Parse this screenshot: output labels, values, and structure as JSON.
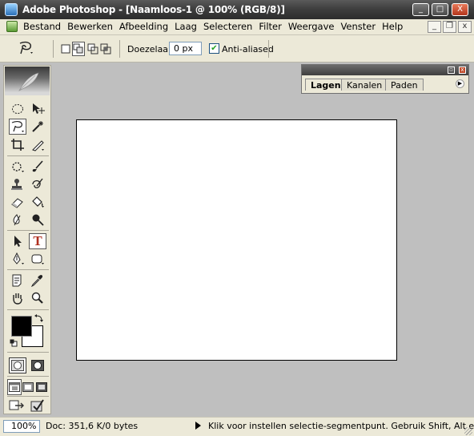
{
  "window": {
    "title": "Adobe Photoshop - [Naamloos-1 @ 100% (RGB/8)]",
    "controls": {
      "minimize": "_",
      "maximize": "□",
      "close": "X"
    }
  },
  "menubar": {
    "items": [
      "Bestand",
      "Bewerken",
      "Afbeelding",
      "Laag",
      "Selecteren",
      "Filter",
      "Weergave",
      "Venster",
      "Help"
    ],
    "mdi_controls": {
      "minimize": "_",
      "restore": "❐",
      "close": "x"
    }
  },
  "options_bar": {
    "feather_label": "Doezelaar:",
    "feather_value": "0 px",
    "antialias_label": "Anti-aliased",
    "antialias_checked": true
  },
  "toolbox": {
    "foreground_color": "#000000",
    "background_color": "#ffffff",
    "tools": [
      {
        "name": "marquee",
        "icon": "◯"
      },
      {
        "name": "move",
        "icon": "✥"
      },
      {
        "name": "lasso",
        "icon": "lasso",
        "active": true
      },
      {
        "name": "magic-wand",
        "icon": "✦"
      },
      {
        "name": "crop",
        "icon": "⌗"
      },
      {
        "name": "slice",
        "icon": "✎"
      },
      {
        "name": "healing",
        "icon": "✺"
      },
      {
        "name": "brush",
        "icon": "✐"
      },
      {
        "name": "clone-stamp",
        "icon": "♙"
      },
      {
        "name": "history-brush",
        "icon": "ϡ"
      },
      {
        "name": "eraser",
        "icon": "▱"
      },
      {
        "name": "paint-bucket",
        "icon": "◆"
      },
      {
        "name": "blur",
        "icon": "♨"
      },
      {
        "name": "dodge",
        "icon": "●"
      },
      {
        "name": "path-selection",
        "icon": "➤"
      },
      {
        "name": "type",
        "icon": "T"
      },
      {
        "name": "pen",
        "icon": "✒"
      },
      {
        "name": "shape",
        "icon": "▢"
      },
      {
        "name": "notes",
        "icon": "≣"
      },
      {
        "name": "eyedropper",
        "icon": "⁄"
      },
      {
        "name": "hand",
        "icon": "✋"
      },
      {
        "name": "zoom",
        "icon": "⚲"
      }
    ]
  },
  "palette": {
    "tabs": [
      "Lagen",
      "Kanalen",
      "Paden"
    ],
    "active_tab": "Lagen"
  },
  "statusbar": {
    "zoom": "100%",
    "doc_size": "Doc: 351,6 K/0 bytes",
    "message": "Klik voor instellen selectie-segmentpunt. Gebruik Shift, Alt en Ctrl voor e"
  },
  "colors": {
    "workspace": "#bfbfbf",
    "chrome": "#ece9d8",
    "titlebar": "#3f3f3f"
  }
}
